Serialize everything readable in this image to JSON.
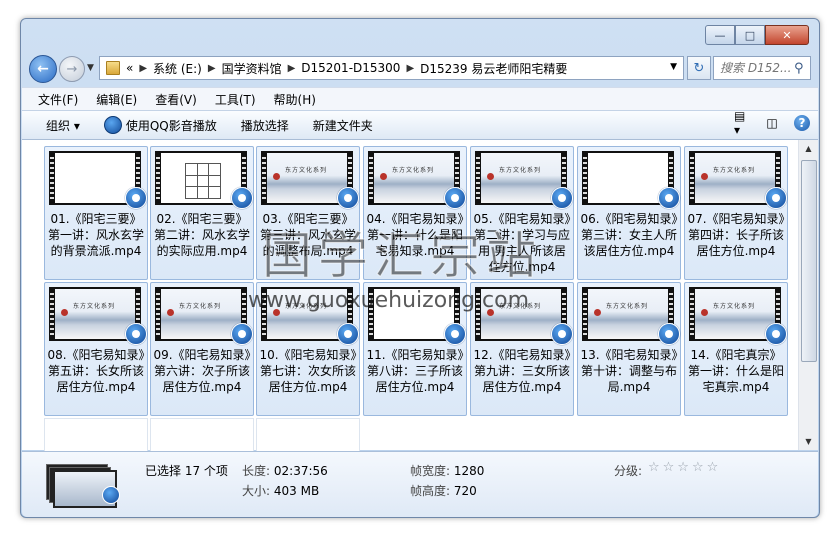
{
  "address": {
    "recent_glyph": "«",
    "segments": [
      "系统 (E:)",
      "国学资料馆",
      "D15201-D15300",
      "D15239 易云老师阳宅精要"
    ]
  },
  "search": {
    "placeholder": "搜索 D152..."
  },
  "menu": [
    "文件(F)",
    "编辑(E)",
    "查看(V)",
    "工具(T)",
    "帮助(H)"
  ],
  "toolbar": {
    "organize": "组织 ▾",
    "qq_play": "使用QQ影音播放",
    "play_selection": "播放选择",
    "new_folder": "新建文件夹"
  },
  "thumb_caption": "东方文化系列",
  "files": [
    {
      "name": "01.《阳宅三要》第一讲：风水玄学的背景流派.mp4",
      "thumb": "blank"
    },
    {
      "name": "02.《阳宅三要》第二讲：风水玄学的实际应用.mp4",
      "thumb": "grid"
    },
    {
      "name": "03.《阳宅三要》第三讲：风水玄学的调整布局.mp4",
      "thumb": "land"
    },
    {
      "name": "04.《阳宅易知录》第一讲：什么是阳宅易知录.mp4",
      "thumb": "land"
    },
    {
      "name": "05.《阳宅易知录》第二讲：学习与应用 男主人所该居住方位.mp4",
      "thumb": "land"
    },
    {
      "name": "06.《阳宅易知录》第三讲：女主人所该居住方位.mp4",
      "thumb": "blank"
    },
    {
      "name": "07.《阳宅易知录》第四讲：长子所该居住方位.mp4",
      "thumb": "land"
    },
    {
      "name": "08.《阳宅易知录》第五讲：长女所该居住方位.mp4",
      "thumb": "land"
    },
    {
      "name": "09.《阳宅易知录》第六讲：次子所该居住方位.mp4",
      "thumb": "land"
    },
    {
      "name": "10.《阳宅易知录》第七讲：次女所该居住方位.mp4",
      "thumb": "land"
    },
    {
      "name": "11.《阳宅易知录》第八讲：三子所该居住方位.mp4",
      "thumb": "blank"
    },
    {
      "name": "12.《阳宅易知录》第九讲：三女所该居住方位.mp4",
      "thumb": "land"
    },
    {
      "name": "13.《阳宅易知录》第十讲：调整与布局.mp4",
      "thumb": "land"
    },
    {
      "name": "14.《阳宅真宗》第一讲：什么是阳宅真宗.mp4",
      "thumb": "land"
    }
  ],
  "watermark": {
    "text": "国学汇宗站",
    "url": "www.guoxuehuizong.com"
  },
  "details": {
    "selected": "已选择 17 个项",
    "length_label": "长度:",
    "length": "02:37:56",
    "size_label": "大小:",
    "size": "403 MB",
    "width_label": "帧宽度:",
    "width": "1280",
    "height_label": "帧高度:",
    "height": "720",
    "rating_label": "分级:",
    "rating_stars": "☆☆☆☆☆"
  }
}
